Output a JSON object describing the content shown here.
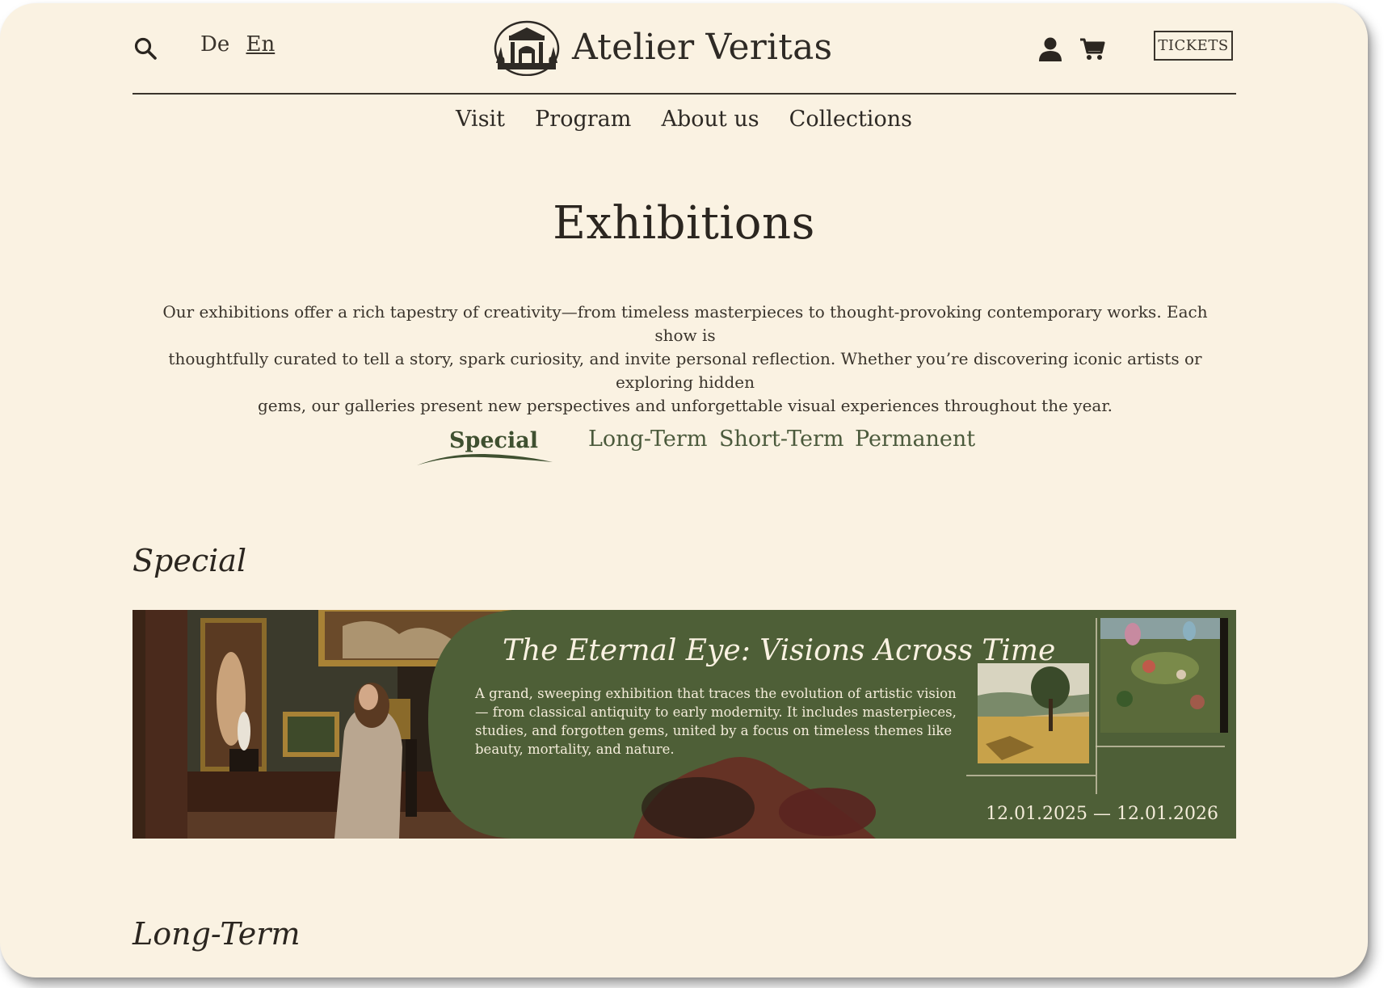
{
  "header": {
    "languages": [
      {
        "label": "De",
        "active": false
      },
      {
        "label": "En",
        "active": true
      }
    ],
    "brand": "Atelier Veritas",
    "tickets_label": "TICKETS",
    "icons": {
      "search": "search-icon",
      "user": "user-icon",
      "cart": "cart-icon",
      "logo": "museum-building-icon"
    }
  },
  "nav": {
    "items": [
      {
        "label": "Visit"
      },
      {
        "label": "Program"
      },
      {
        "label": "About us"
      },
      {
        "label": "Collections"
      }
    ]
  },
  "page": {
    "title": "Exhibitions",
    "intro_lines": [
      "Our exhibitions offer a rich tapestry of creativity—from timeless masterpieces to thought-provoking contemporary works. Each show is",
      "thoughtfully curated to tell a story, spark curiosity, and invite personal reflection. Whether you’re discovering iconic artists or exploring hidden",
      "gems, our galleries present new perspectives and unforgettable visual experiences throughout the year."
    ]
  },
  "tabs": {
    "active": "Special",
    "items": [
      {
        "label": "Special"
      },
      {
        "label": "Long-Term"
      },
      {
        "label": "Short-Term"
      },
      {
        "label": "Permanent"
      }
    ]
  },
  "sections": [
    {
      "title": "Special",
      "card": {
        "title": "The Eternal Eye: Visions Across Time",
        "description": "A grand, sweeping exhibition that traces the evolution of artistic vision — from classical antiquity to early modernity. It includes masterpieces, studies, and forgotten gems, united by a focus on timeless themes like beauty, mortality, and nature.",
        "date_range": "12.01.2025  — 12.01.2026"
      }
    },
    {
      "title": "Long-Term"
    }
  ],
  "colors": {
    "background": "#faf2e2",
    "accent_green": "#4e5f37",
    "text": "#2b2620",
    "tab_green": "#4b5a3c"
  }
}
